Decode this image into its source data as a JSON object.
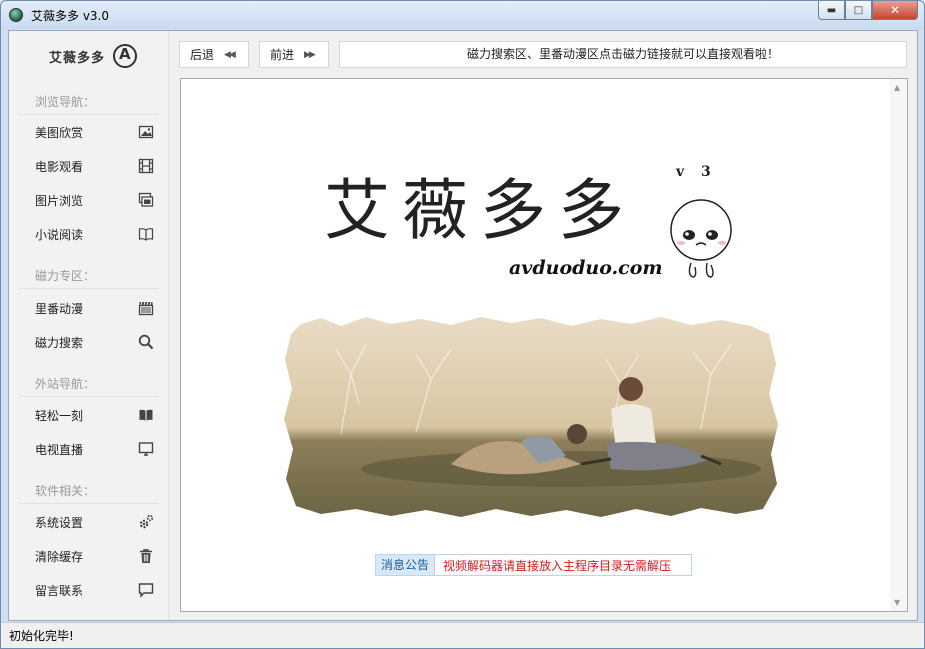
{
  "window": {
    "title": "艾薇多多 v3.0"
  },
  "sidebar": {
    "logo_text": "艾薇多多",
    "sections": [
      {
        "label": "浏览导航：",
        "items": [
          {
            "label": "美图欣赏",
            "icon": "image-icon"
          },
          {
            "label": "电影观看",
            "icon": "film-icon"
          },
          {
            "label": "图片浏览",
            "icon": "gallery-icon"
          },
          {
            "label": "小说阅读",
            "icon": "book-icon"
          }
        ]
      },
      {
        "label": "磁力专区：",
        "items": [
          {
            "label": "里番动漫",
            "icon": "clapper-icon"
          },
          {
            "label": "磁力搜索",
            "icon": "search-icon"
          }
        ]
      },
      {
        "label": "外站导航：",
        "items": [
          {
            "label": "轻松一刻",
            "icon": "open-book-icon"
          },
          {
            "label": "电视直播",
            "icon": "monitor-icon"
          }
        ]
      },
      {
        "label": "软件相关：",
        "items": [
          {
            "label": "系统设置",
            "icon": "gear-icon"
          },
          {
            "label": "清除缓存",
            "icon": "trash-icon"
          },
          {
            "label": "留言联系",
            "icon": "message-icon"
          }
        ]
      }
    ]
  },
  "toolbar": {
    "back_label": "后退",
    "forward_label": "前进",
    "notice": "磁力搜索区、里番动漫区点击磁力链接就可以直接观看啦！"
  },
  "content": {
    "brand": "艾薇多多",
    "version": "v 3",
    "url": "avduoduo.com",
    "bulletin_tag": "消息公告",
    "bulletin_text": "视频解码器请直接放入主程序目录无需解压"
  },
  "status": {
    "text": "初始化完毕!"
  }
}
